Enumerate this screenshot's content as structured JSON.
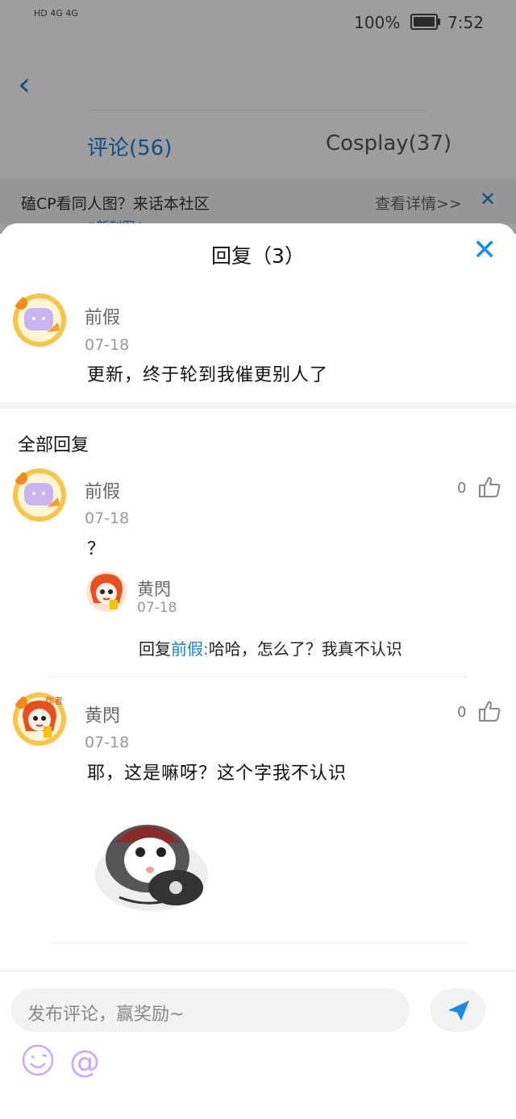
{
  "status_bar": {
    "left": "HD 4G 4G",
    "battery": "100%",
    "time": "7:52"
  },
  "background_page": {
    "tabs": [
      {
        "label": "评论(56)",
        "active": true
      },
      {
        "label": "Cosplay(37)",
        "active": false
      }
    ],
    "banner": {
      "text": "磕CP看同人图？来话本社区",
      "detail": "查看详情>>"
    },
    "peek_text": "#新刊图↓"
  },
  "sheet": {
    "title": "回复（3）",
    "main_comment": {
      "user": "前假",
      "date": "07-18",
      "text": "更新，终于轮到我催更别人了"
    },
    "section_title": "全部回复",
    "replies": [
      {
        "user": "前假",
        "date": "07-18",
        "text": "？",
        "likes": "0",
        "sub_reply": {
          "user": "黄閃",
          "date": "07-18",
          "prefix": "回复",
          "target": "前假:",
          "text": "哈哈，怎么了？我真不认识"
        }
      },
      {
        "user": "黄閃",
        "date": "07-18",
        "text": "耶，这是嘛呀？这个字我不认识",
        "likes": "0",
        "badge": "作者"
      }
    ],
    "badge_author": "作者"
  },
  "input_bar": {
    "placeholder": "发布评论，赢奖励~",
    "at_symbol": "@"
  },
  "colors": {
    "accent": "#1a7fd6",
    "send": "#1a8ce8",
    "emoji": "#c8a9ff"
  }
}
